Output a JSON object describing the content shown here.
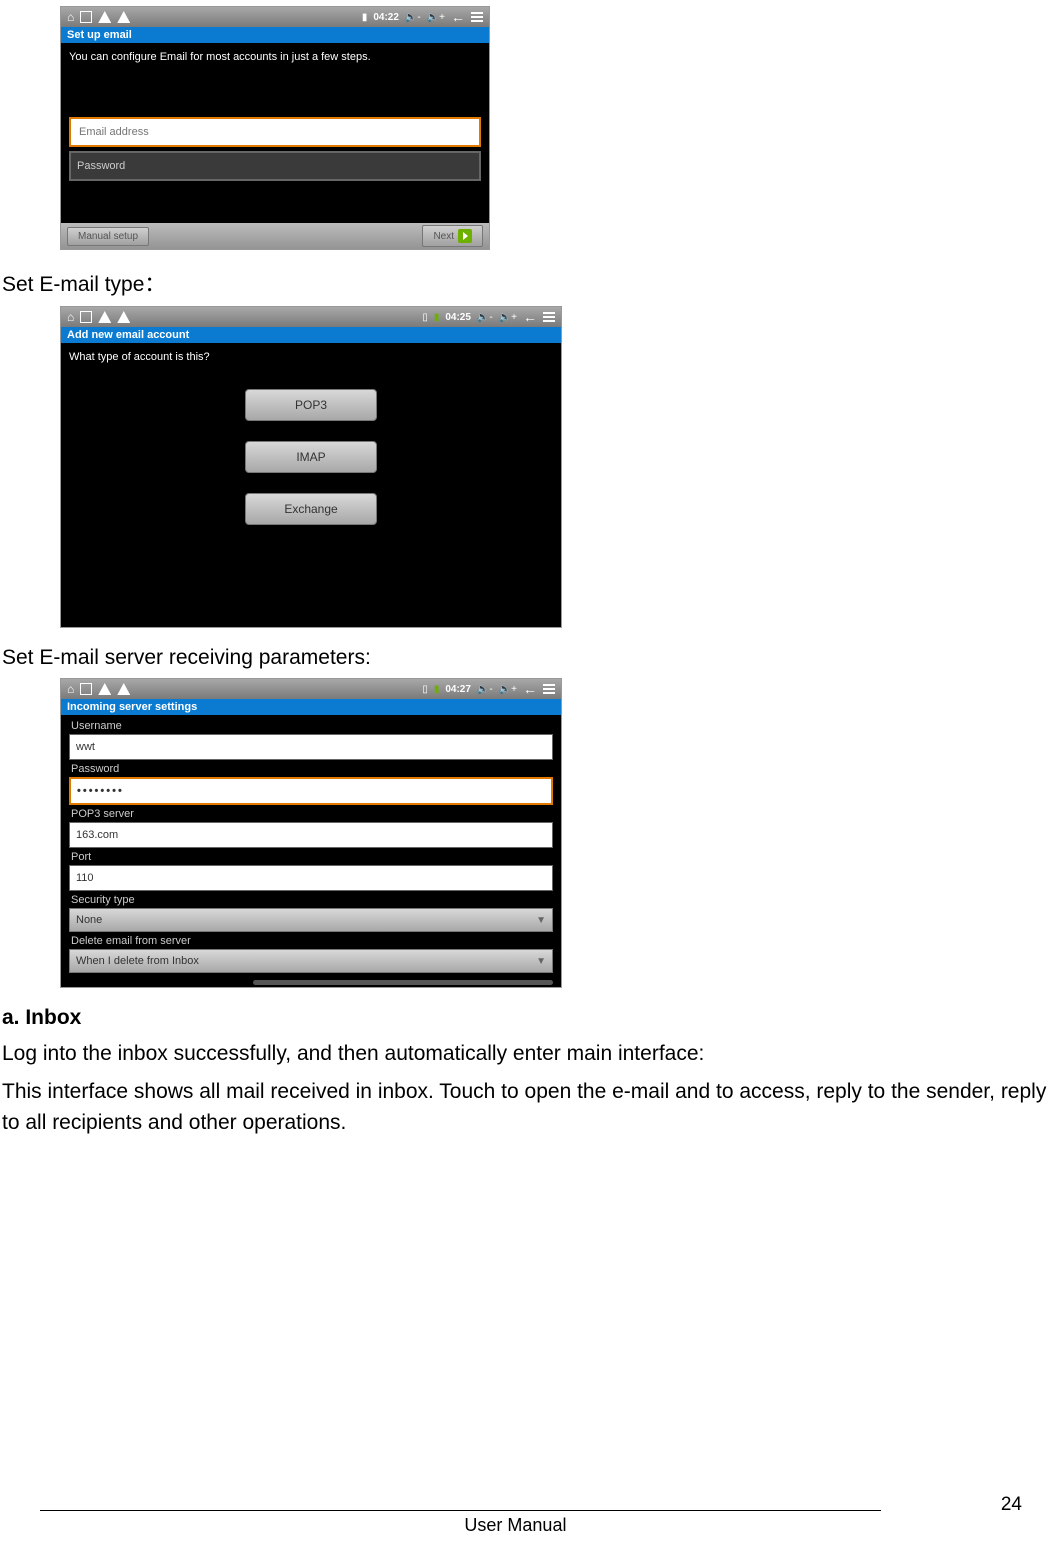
{
  "captions": {
    "set_type": "Set E-mail type：",
    "set_server": "Set E-mail server receiving parameters:"
  },
  "inbox": {
    "heading": "a. Inbox",
    "p1": "Log into the inbox successfully, and then automatically enter main interface:",
    "p2": "This interface shows all mail received in inbox. Touch to open the e-mail and to access, reply to the sender, reply to all recipients and other operations."
  },
  "ss1": {
    "time": "04:22",
    "title": "Set up email",
    "instruction": "You can configure Email for most accounts in just a few steps.",
    "email_placeholder": "Email address",
    "password_placeholder": "Password",
    "manual_btn": "Manual setup",
    "next_btn": "Next"
  },
  "ss2": {
    "time": "04:25",
    "title": "Add new email account",
    "question": "What type of account is this?",
    "opt1": "POP3",
    "opt2": "IMAP",
    "opt3": "Exchange"
  },
  "ss3": {
    "time": "04:27",
    "title": "Incoming server settings",
    "labels": {
      "username": "Username",
      "password": "Password",
      "pop3server": "POP3 server",
      "port": "Port",
      "security": "Security type",
      "delete": "Delete email from server"
    },
    "values": {
      "username": "wwt",
      "password": "••••••••",
      "pop3server": "163.com",
      "port": "110",
      "security": "None",
      "delete": "When I delete from Inbox"
    }
  },
  "footer": {
    "center": "User Manual",
    "page": "24"
  }
}
